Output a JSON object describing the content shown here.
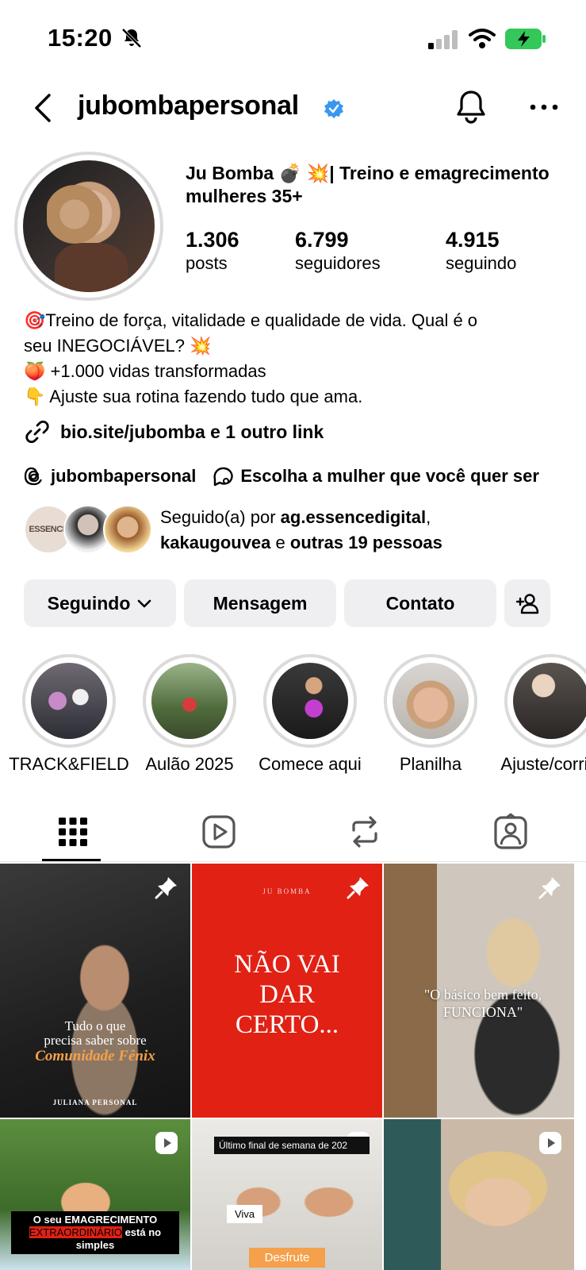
{
  "status_bar": {
    "time": "15:20",
    "icons": [
      "bell-off-icon",
      "signal-icon",
      "wifi-icon",
      "battery-charging-icon"
    ]
  },
  "header": {
    "username": "jubombapersonal",
    "verified": true,
    "icons": [
      "back-icon",
      "verified-badge-icon",
      "bell-icon",
      "more-icon"
    ]
  },
  "profile": {
    "display_name": "Ju Bomba 💣 💥| Treino e emagrecimento mulheres 35+",
    "stats": [
      {
        "value": "1.306",
        "label": "posts"
      },
      {
        "value": "6.799",
        "label": "seguidores"
      },
      {
        "value": "4.915",
        "label": "seguindo"
      }
    ],
    "bio": [
      "🎯Treino de força, vitalidade e qualidade de vida. Qual é o",
      "seu INEGOCIÁVEL? 💥",
      "🍑 +1.000 vidas transformadas",
      "👇 Ajuste sua rotina fazendo tudo que ama."
    ],
    "link": "bio.site/jubomba e 1 outro link",
    "threads_handle": "jubombapersonal",
    "channel": "Escolha a mulher que você quer ser",
    "followed_by": {
      "prefix": "Seguido(a) por ",
      "user1": "ag.essencedigital",
      "sep1": ",",
      "user2": "kakaugouvea",
      "sep2": " e ",
      "others": "outras 19 pessoas"
    },
    "essence_avatar_text": "ESSENCE"
  },
  "actions": {
    "following": "Seguindo",
    "message": "Mensagem",
    "contact": "Contato"
  },
  "highlights": [
    {
      "label": "TRACK&FIELD"
    },
    {
      "label": "Aulão 2025"
    },
    {
      "label": "Comece aqui"
    },
    {
      "label": "Planilha"
    },
    {
      "label": "Ajuste/corrija"
    }
  ],
  "tabs": [
    "grid-icon",
    "reels-icon",
    "reposts-icon",
    "tagged-icon"
  ],
  "posts": [
    {
      "type": "pinned",
      "line1": "Tudo o que",
      "line2": "precisa saber sobre",
      "highlight": "Comunidade Fênix",
      "footer": "JULIANA PERSONAL"
    },
    {
      "type": "pinned",
      "brand": "JU BOMBA",
      "headline": [
        "NÃO VAI",
        "DAR",
        "CERTO..."
      ]
    },
    {
      "type": "pinned",
      "quote": [
        "\"O básico bem feito,",
        "FUNCIONA\""
      ]
    },
    {
      "type": "reel",
      "caption1": "O seu EMAGRECIMENTO",
      "caption2a": "EXTRAORDINÁRIO",
      "caption2b": "está no simples"
    },
    {
      "type": "reel",
      "top": "Último final de semana de 202",
      "tag": "Viva",
      "bottom": "Desfrute"
    },
    {
      "type": "reel"
    }
  ],
  "colors": {
    "accent_blue": "#3897f0",
    "button_bg": "#efeff2",
    "battery_green": "#34c759",
    "red_post": "#e02114",
    "orange_text": "#f5a04a"
  }
}
